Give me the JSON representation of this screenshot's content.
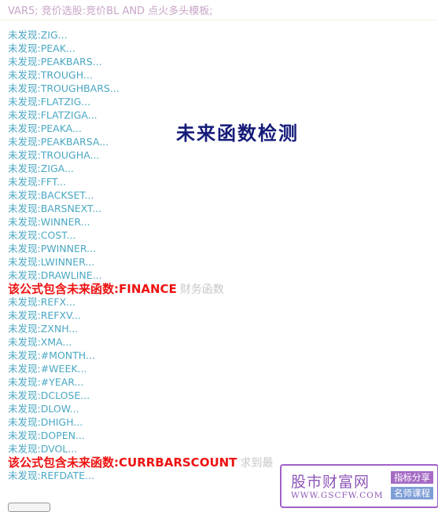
{
  "header": {
    "formula_line": "VAR5; 竞价选股:竞价BL AND 点火多头模板;"
  },
  "heading": "未来函数检测",
  "lines": [
    {
      "kind": "ok",
      "text": "未发现:ZIG..."
    },
    {
      "kind": "ok",
      "text": "未发现:PEAK..."
    },
    {
      "kind": "ok",
      "text": "未发现:PEAKBARS..."
    },
    {
      "kind": "ok",
      "text": "未发现:TROUGH..."
    },
    {
      "kind": "ok",
      "text": "未发现:TROUGHBARS..."
    },
    {
      "kind": "ok",
      "text": "未发现:FLATZIG..."
    },
    {
      "kind": "ok",
      "text": "未发现:FLATZIGA..."
    },
    {
      "kind": "ok",
      "text": "未发现:PEAKA..."
    },
    {
      "kind": "ok",
      "text": "未发现:PEAKBARSA..."
    },
    {
      "kind": "ok",
      "text": "未发现:TROUGHA..."
    },
    {
      "kind": "ok",
      "text": "未发现:ZIGA..."
    },
    {
      "kind": "ok",
      "text": "未发现:FFT..."
    },
    {
      "kind": "ok",
      "text": "未发现:BACKSET..."
    },
    {
      "kind": "ok",
      "text": "未发现:BARSNEXT..."
    },
    {
      "kind": "ok",
      "text": "未发现:WINNER..."
    },
    {
      "kind": "ok",
      "text": "未发现:COST..."
    },
    {
      "kind": "ok",
      "text": "未发现:PWINNER..."
    },
    {
      "kind": "ok",
      "text": "未发现:LWINNER..."
    },
    {
      "kind": "ok",
      "text": "未发现:DRAWLINE..."
    },
    {
      "kind": "warn",
      "text": "该公式包含未来函数:FINANCE",
      "desc": "财务函数"
    },
    {
      "kind": "ok",
      "text": "未发现:REFX..."
    },
    {
      "kind": "ok",
      "text": "未发现:REFXV..."
    },
    {
      "kind": "ok",
      "text": "未发现:ZXNH..."
    },
    {
      "kind": "ok",
      "text": "未发现:XMA..."
    },
    {
      "kind": "ok",
      "text": "未发现:#MONTH..."
    },
    {
      "kind": "ok",
      "text": "未发现:#WEEK..."
    },
    {
      "kind": "ok",
      "text": "未发现:#YEAR..."
    },
    {
      "kind": "ok",
      "text": "未发现:DCLOSE..."
    },
    {
      "kind": "ok",
      "text": "未发现:DLOW..."
    },
    {
      "kind": "ok",
      "text": "未发现:DHIGH..."
    },
    {
      "kind": "ok",
      "text": "未发现:DOPEN..."
    },
    {
      "kind": "ok",
      "text": "未发现:DVOL..."
    },
    {
      "kind": "warn",
      "text": "该公式包含未来函数:CURRBARSCOUNT",
      "desc": "求到最"
    },
    {
      "kind": "ok",
      "text": "未发现:REFDATE..."
    }
  ],
  "watermark": {
    "title": "股市财富网",
    "url": "WWW.GSCFW.COM",
    "tag1": "指标分享",
    "tag2": "名师课程"
  }
}
